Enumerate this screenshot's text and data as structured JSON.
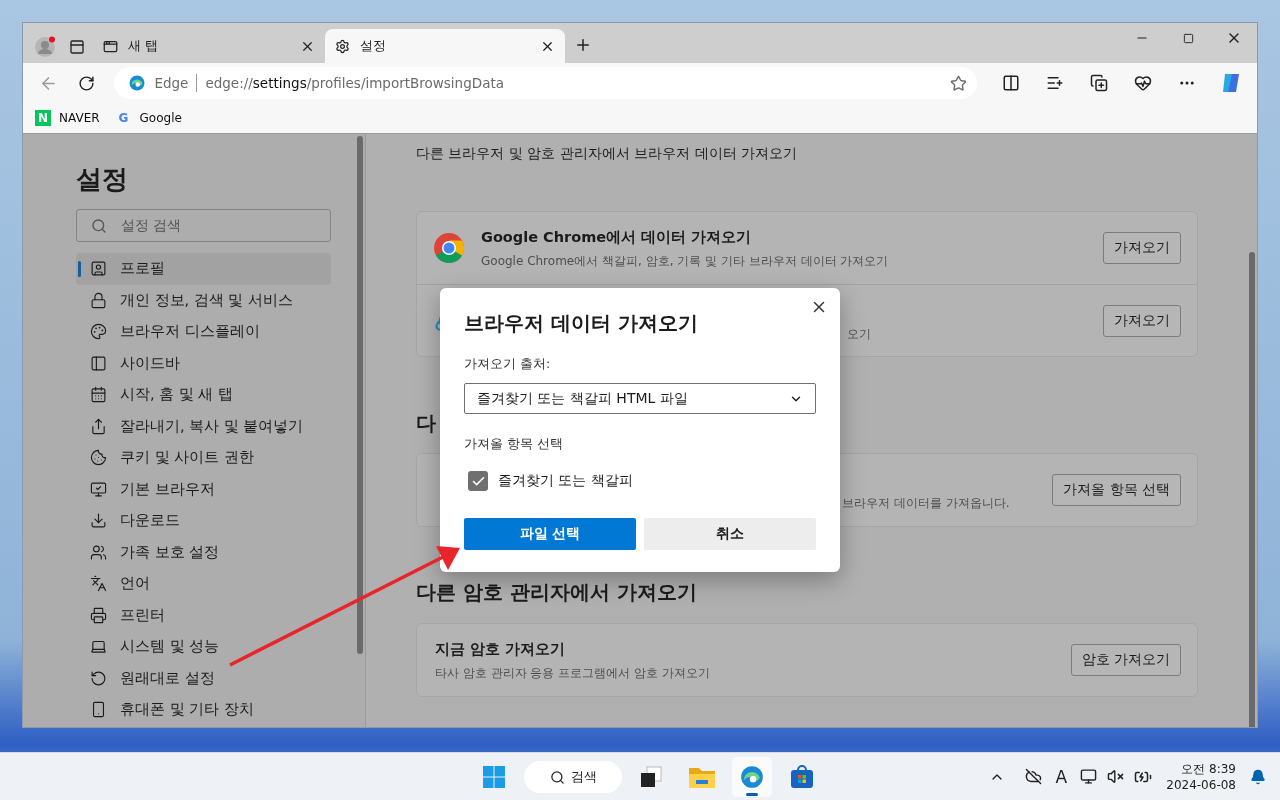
{
  "window": {
    "tabs": [
      {
        "label": "새 탭",
        "selected": false
      },
      {
        "label": "설정",
        "selected": true
      }
    ]
  },
  "address_bar": {
    "back_disabled": true,
    "site_label": "Edge",
    "url": "edge://**settings**/profiles/importBrowsingData"
  },
  "bookmarks": [
    {
      "logo_text": "N",
      "label": "NAVER"
    },
    {
      "logo_text": "G",
      "label": "Google"
    }
  ],
  "sidebar": {
    "title": "설정",
    "search_placeholder": "설정 검색",
    "items": [
      {
        "label": "프로필",
        "selected": true
      },
      {
        "label": "개인 정보, 검색 및 서비스",
        "selected": false
      },
      {
        "label": "브라우저 디스플레이",
        "selected": false
      },
      {
        "label": "사이드바",
        "selected": false
      },
      {
        "label": "시작, 홈 및 새 탭",
        "selected": false
      },
      {
        "label": "잘라내기, 복사 및 붙여넣기",
        "selected": false
      },
      {
        "label": "쿠키 및 사이트 권한",
        "selected": false
      },
      {
        "label": "기본 브라우저",
        "selected": false
      },
      {
        "label": "다운로드",
        "selected": false
      },
      {
        "label": "가족 보호 설정",
        "selected": false
      },
      {
        "label": "언어",
        "selected": false
      },
      {
        "label": "프린터",
        "selected": false
      },
      {
        "label": "시스템 및 성능",
        "selected": false
      },
      {
        "label": "원래대로 설정",
        "selected": false
      },
      {
        "label": "휴대폰 및 기타 장치",
        "selected": false
      }
    ]
  },
  "main": {
    "intro": "다른 브라우저 및 암호 관리자에서 브라우저 데이터 가져오기",
    "sections": [
      {
        "rows": [
          {
            "title": "Google Chrome에서 데이터 가져오기",
            "desc": "Google Chrome에서 책갈피, 암호, 기록 및 기타 브라우저 데이터 가져오기",
            "button": "가져오기"
          },
          {
            "desc_tail": "오기",
            "button": "가져오기"
          }
        ]
      },
      {
        "heading": "다",
        "rows": [
          {
            "desc_tail": "브라우저 데이터를 가져옵니다.",
            "button": "가져올 항목 선택"
          }
        ]
      },
      {
        "heading": "다른 암호 관리자에서 가져오기",
        "rows": [
          {
            "title": "지금 암호 가져오기",
            "desc": "타사 암호 관리자 응용 프로그램에서 암호 가져오기",
            "button": "암호 가져오기"
          }
        ]
      }
    ]
  },
  "dialog": {
    "title": "브라우저 데이터 가져오기",
    "source_label": "가져오기 출처:",
    "source_value": "즐겨찾기 또는 책갈피 HTML 파일",
    "items_label": "가져올 항목 선택",
    "items": [
      {
        "label": "즐겨찾기 또는 책갈피",
        "checked": true
      }
    ],
    "buttons": [
      {
        "label": "파일 선택",
        "kind": "primary"
      },
      {
        "label": "취소",
        "kind": "secondary"
      }
    ]
  },
  "taskbar": {
    "search": "검색",
    "apps": [
      {
        "active": false
      },
      {
        "active": false
      },
      {
        "active": true
      },
      {
        "active": false
      }
    ],
    "ime": "A",
    "time": "오전 8:39",
    "date": "2024-06-08"
  }
}
